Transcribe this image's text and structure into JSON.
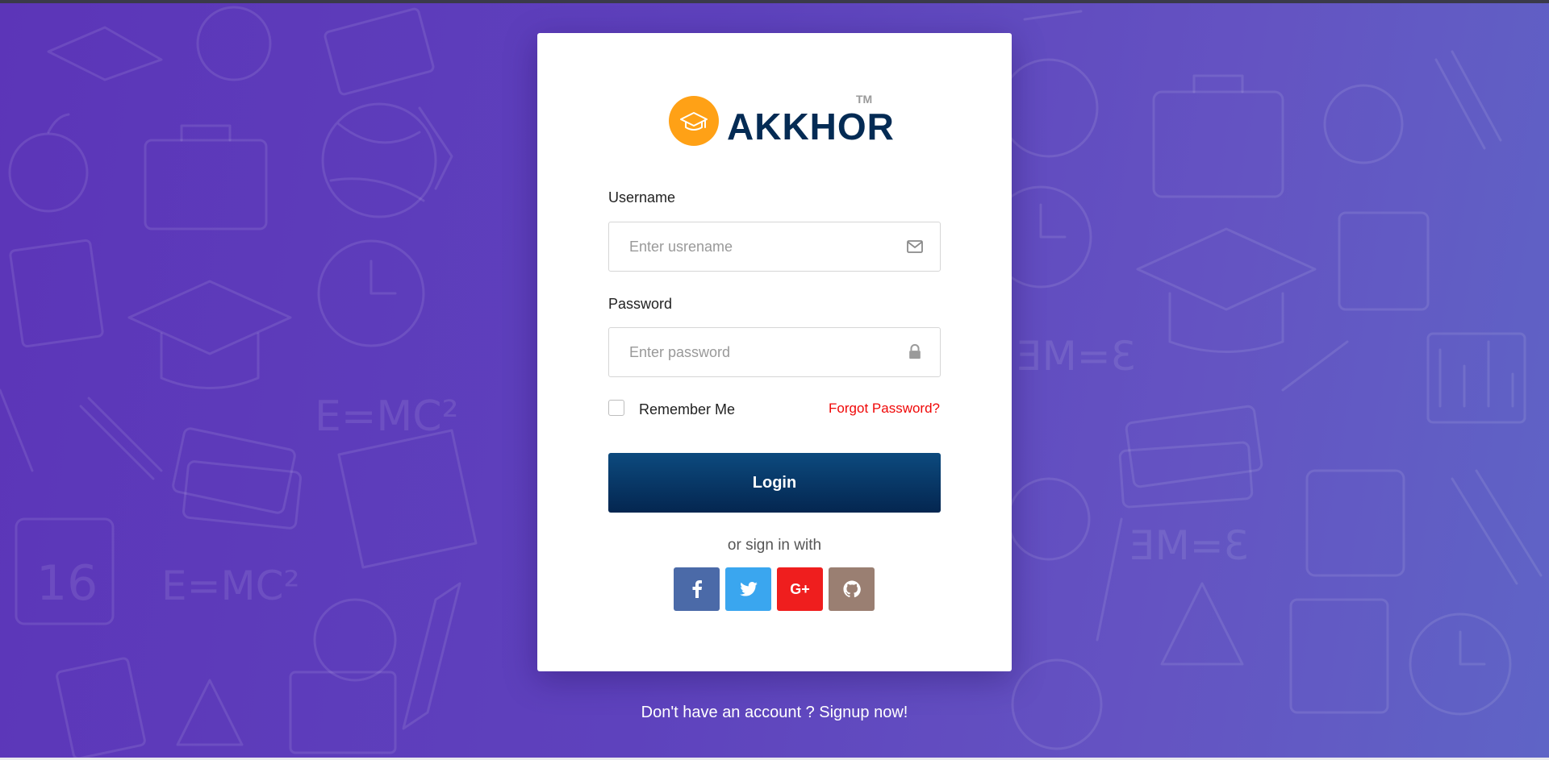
{
  "brand": {
    "name": "AKKHOR",
    "trademark": "TM"
  },
  "form": {
    "username_label": "Username",
    "username_placeholder": "Enter usrename",
    "password_label": "Password",
    "password_placeholder": "Enter password",
    "remember_label": "Remember Me",
    "forgot_label": "Forgot Password?",
    "login_label": "Login",
    "or_text": "or sign in with"
  },
  "social": [
    {
      "name": "facebook",
      "color": "#4b6aa8"
    },
    {
      "name": "twitter",
      "color": "#3aa6ef"
    },
    {
      "name": "google-plus",
      "glyph": "G+",
      "color": "#ef1e1e"
    },
    {
      "name": "github",
      "color": "#9a7f72"
    }
  ],
  "footer": {
    "signup_text": "Don't have an account ? Signup now!"
  },
  "colors": {
    "accent": "#ffa116",
    "brand_text": "#042b54",
    "primary_button": "#063768",
    "link": "#f00707",
    "background": "#5e3fbc"
  }
}
